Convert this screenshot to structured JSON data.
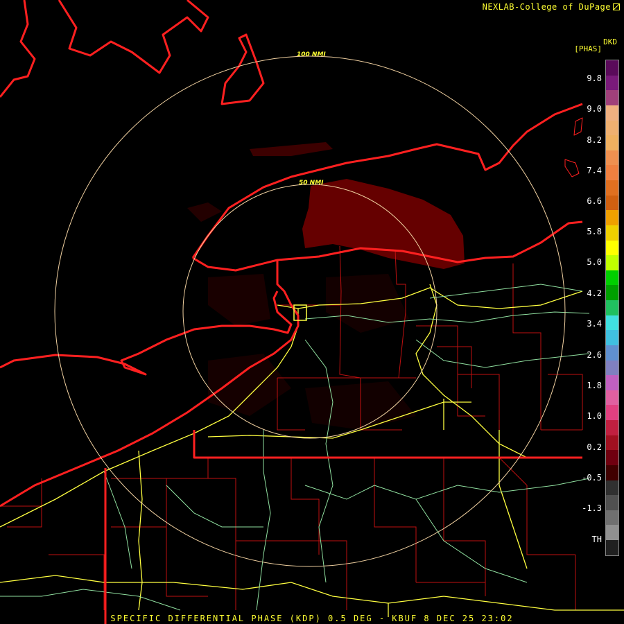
{
  "header": {
    "credit": "NEXLAB-College of DuPage",
    "credit_icon": "expand-icon"
  },
  "legend": {
    "product_code": "DKD",
    "units": "[PHAS]",
    "ticks": [
      "9.8",
      "9.0",
      "8.2",
      "7.4",
      "6.6",
      "5.8",
      "5.0",
      "4.2",
      "3.4",
      "2.6",
      "1.8",
      "1.0",
      "0.2",
      "-0.5",
      "-1.3",
      "TH"
    ],
    "colors": [
      "#5a0a5a",
      "#7a1a7a",
      "#a0407a",
      "#f0b080",
      "#f0b070",
      "#f0b060",
      "#f09050",
      "#f08040",
      "#e07020",
      "#d06010",
      "#f0a000",
      "#f0d000",
      "#ffff00",
      "#c0ff00",
      "#00d000",
      "#00a000",
      "#20c060",
      "#40e0e0",
      "#40c0e0",
      "#6090d0",
      "#8080c0",
      "#c060c0",
      "#e060a0",
      "#e04080",
      "#c02040",
      "#a01020",
      "#700010",
      "#400000",
      "#303030",
      "#505050",
      "#707070",
      "#909090",
      "#202020"
    ]
  },
  "rings": {
    "inner_label": "50 NMI",
    "outer_label": "100 NMI"
  },
  "footer": {
    "caption": "SPECIFIC DIFFERENTIAL PHASE (KDP) 0.5 DEG - KBUF 8 DEC 25 23:02"
  },
  "colors": {
    "text": "#ffff33",
    "border_red": "#ff2020",
    "county_red": "#c01010",
    "highway_yellow": "#ffff40",
    "highway_green": "#90e0a0",
    "ring": "#f0d0a0",
    "echo": "#6a0000"
  }
}
